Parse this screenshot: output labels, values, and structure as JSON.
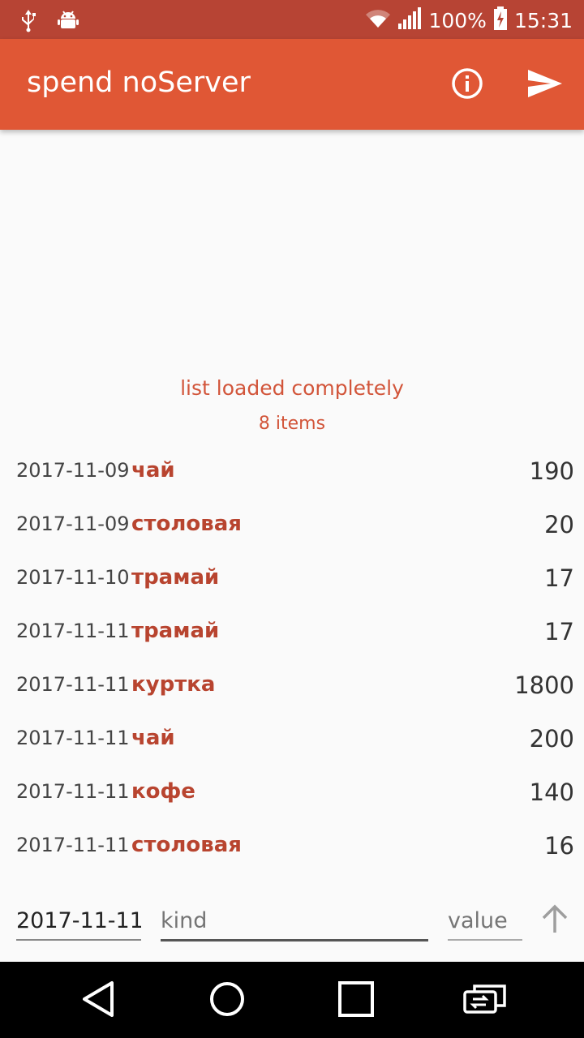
{
  "status_bar": {
    "icons_left": [
      "usb-icon",
      "android-debug-icon"
    ],
    "icons_right": [
      "wifi-icon",
      "signal-icon",
      "battery-charging-icon"
    ],
    "battery": "100%",
    "time": "15:31"
  },
  "app_bar": {
    "title": "spend noServer",
    "actions": [
      "info-icon",
      "send-icon"
    ],
    "color": "#e05735"
  },
  "load_status": {
    "message": "list loaded completely",
    "count": "8 items",
    "color": "#d2553a"
  },
  "items": [
    {
      "date": "2017-11-09",
      "kind": "чай",
      "value": "190"
    },
    {
      "date": "2017-11-09",
      "kind": "столовая",
      "value": "20"
    },
    {
      "date": "2017-11-10",
      "kind": "трамай",
      "value": "17"
    },
    {
      "date": "2017-11-11",
      "kind": "трамай",
      "value": "17"
    },
    {
      "date": "2017-11-11",
      "kind": "куртка",
      "value": "1800"
    },
    {
      "date": "2017-11-11",
      "kind": "чай",
      "value": "200"
    },
    {
      "date": "2017-11-11",
      "kind": "кофе",
      "value": "140"
    },
    {
      "date": "2017-11-11",
      "kind": "столовая",
      "value": "16"
    }
  ],
  "entry_form": {
    "date_value": "2017-11-11",
    "kind_placeholder": "kind",
    "value_placeholder": "value",
    "submit_icon": "arrow-up-icon"
  },
  "nav_bar": {
    "buttons": [
      "back-icon",
      "home-icon",
      "recents-icon",
      "switch-app-icon"
    ]
  }
}
